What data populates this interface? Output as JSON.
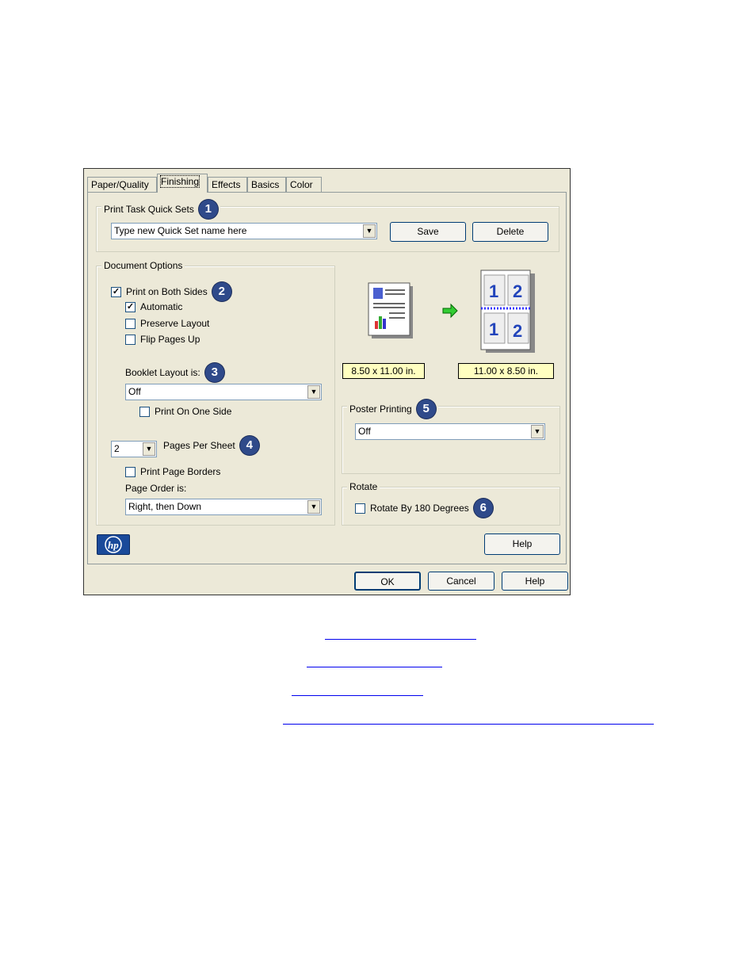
{
  "tabs": [
    "Paper/Quality",
    "Finishing",
    "Effects",
    "Basics",
    "Color"
  ],
  "quicksets": {
    "legend": "Print Task Quick Sets",
    "badge": "1",
    "combo_value": "Type new Quick Set name here",
    "save": "Save",
    "delete": "Delete"
  },
  "doc_options": {
    "legend": "Document Options",
    "print_both_sides": "Print on Both Sides",
    "badge2": "2",
    "automatic": "Automatic",
    "preserve_layout": "Preserve Layout",
    "flip_pages_up": "Flip Pages Up",
    "booklet_label": "Booklet Layout is:",
    "badge3": "3",
    "booklet_value": "Off",
    "print_one_side": "Print On One Side",
    "pages_value": "2",
    "pages_per_sheet": "Pages Per Sheet",
    "badge4": "4",
    "print_page_borders": "Print Page Borders",
    "page_order_label": "Page Order is:",
    "page_order_value": "Right, then Down"
  },
  "preview": {
    "size_left": "8.50 x 11.00 in.",
    "size_right": "11.00 x 8.50 in."
  },
  "poster": {
    "legend": "Poster Printing",
    "badge": "5",
    "value": "Off"
  },
  "rotate": {
    "legend": "Rotate",
    "checkbox": "Rotate By 180 Degrees",
    "badge": "6"
  },
  "help_inner": "Help",
  "footer": {
    "ok": "OK",
    "cancel": "Cancel",
    "help": "Help"
  },
  "colors": {
    "dialog_bg": "#ece9d8",
    "badge": "#2f4a8a",
    "hp_logo": "#1a4a9a"
  }
}
